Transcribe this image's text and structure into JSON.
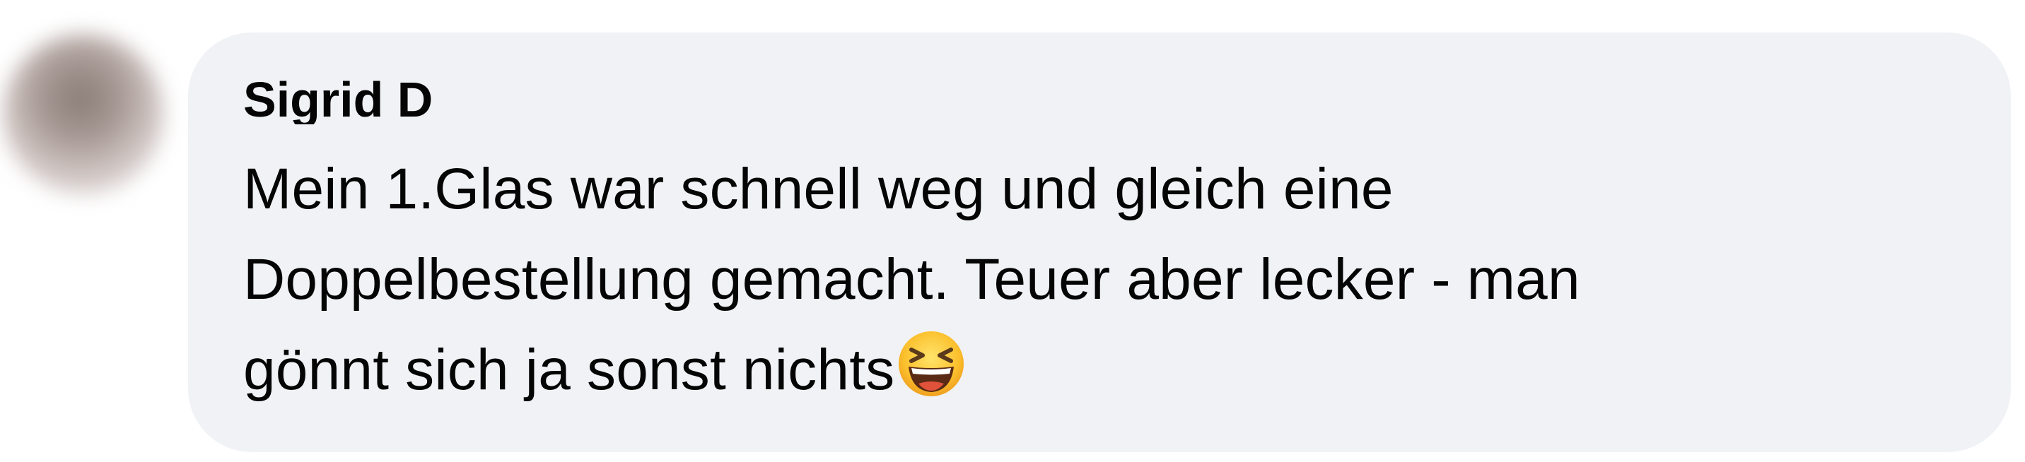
{
  "comment": {
    "author": "Sigrid D",
    "text_line_1": "Mein 1.Glas war schnell weg und gleich eine",
    "text_line_2": "Doppelbestellung gemacht. Teuer aber lecker - man",
    "text_line_3": "gönnt sich ja sonst nichts",
    "emoji": "grinning-squinting-face-icon"
  },
  "colors": {
    "bubble_background": "#f0f2f5",
    "text": "#050505"
  }
}
